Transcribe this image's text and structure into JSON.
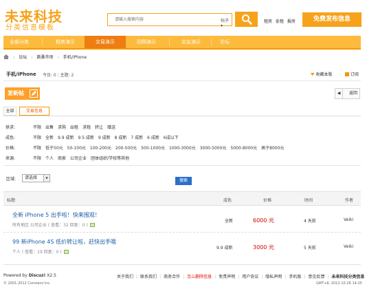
{
  "header": {
    "logo_title": "未来科技",
    "logo_subtitle": "分类信息模板",
    "search_placeholder": "请输入搜索内容",
    "search_category": "帖子",
    "top_links": [
      "租房",
      "俞租",
      "报房"
    ],
    "publish_label": "免费发布信息",
    "accent_color": "#f7a21b"
  },
  "nav": {
    "items": [
      "全部分类",
      "租房演示",
      "交易演示",
      "回顾演示",
      "交友演示",
      "论坛"
    ],
    "active_index": 2
  },
  "breadcrumb": [
    "论坛",
    "跳蚤市场",
    "手机/iPhone"
  ],
  "forum": {
    "title": "手机/iPhone",
    "today_label": "今日: 0",
    "topics_label": "主题: 2",
    "fav_label": "收藏本版",
    "rss_label": "订阅"
  },
  "actions": {
    "new_post": "发新帖",
    "back": "返回"
  },
  "tabs": [
    "全部",
    "交易信息"
  ],
  "filters": [
    {
      "label": "供求:",
      "options": [
        "不限",
        "出售",
        "求购",
        "出租",
        "求租",
        "转让",
        "赠送"
      ]
    },
    {
      "label": "成色:",
      "options": [
        "不限",
        "全新",
        "9.9 成新",
        "9.5 成新",
        "9 成新",
        "8 成新",
        "7 成新",
        "6 成新",
        "6成以下"
      ]
    },
    {
      "label": "价格:",
      "options": [
        "不限",
        "低于50元",
        "50-100元",
        "100-200元",
        "200-500元",
        "500-1000元",
        "1000-3000元",
        "3000-5000元",
        "5000-8000元",
        "高于8000元"
      ]
    },
    {
      "label": "来源:",
      "options": [
        "不限",
        "个人",
        "商家",
        "公司企业",
        "团体组织/学校等其他"
      ]
    }
  ],
  "region": {
    "label": "区域:",
    "selected": "请选择",
    "search_button": "搜索"
  },
  "table": {
    "headers": [
      "标题",
      "成色",
      "价格",
      "时间",
      "作者"
    ],
    "rows": [
      {
        "title": "全新 iPhone 5 出手啦！快来围观！",
        "meta": "所有地区 公司企业 ( 查看：32 回复：0 )",
        "condition": "全新",
        "price": "6000 元",
        "time": "4 天前",
        "author": "Veiki"
      },
      {
        "title": "99 新iPhone 4S 低价转让啦，赶快出手哦",
        "meta": "个人 ( 查看：19 回复：0 )",
        "condition": "9.9 成新",
        "price": "3000 元",
        "time": "5 天前",
        "author": "Veiki"
      }
    ]
  },
  "footer": {
    "powered_prefix": "Powered by",
    "powered_brand": "Discuz!",
    "powered_version": "X2.5",
    "copyright": "© 2001-2012 Comsenz Inc.",
    "links": [
      "关于我们",
      "联系我们",
      "商务合作",
      "怎么删除信息",
      "免责声明",
      "用户协议",
      "隐私声明",
      "手机版",
      "意见反馈",
      "未来科技分类信息"
    ],
    "gmt": "GMT+8, 2012-10-26 14:25"
  }
}
